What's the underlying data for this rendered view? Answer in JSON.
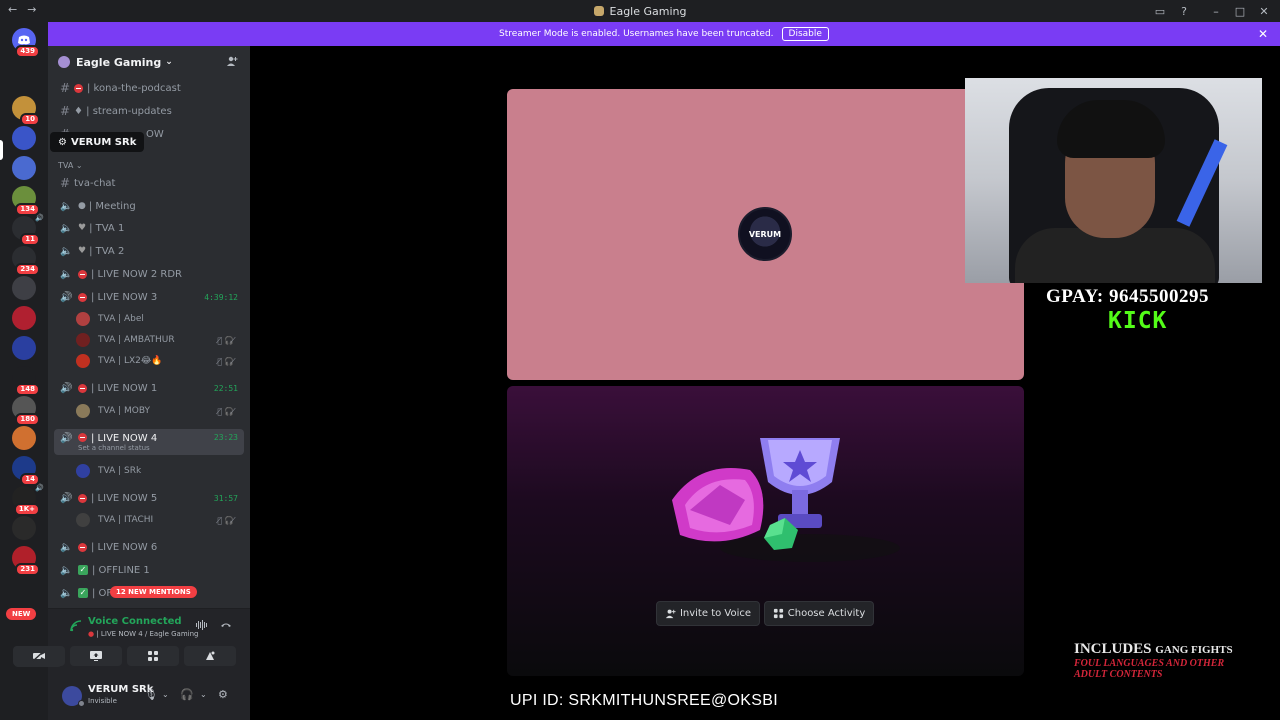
{
  "window": {
    "title": "Eagle Gaming",
    "nav_back": "←",
    "nav_fwd": "→",
    "controls": {
      "inbox": "▭",
      "help": "?",
      "minimize": "–",
      "maximize": "□",
      "close": "✕"
    }
  },
  "banner": {
    "text": "Streamer Mode is enabled. Usernames have been truncated.",
    "disable_label": "Disable",
    "close": "✕",
    "color": "#7a3cf4"
  },
  "guild_rail": {
    "home_badge": "439",
    "items": [
      {
        "badge": "10",
        "color": "#c3913a"
      },
      {
        "badge": "",
        "color": "#3a55c8"
      },
      {
        "badge": "",
        "color": "#4a6ad0"
      },
      {
        "badge": "134",
        "color": "#6b8f3c"
      },
      {
        "badge": "11",
        "color": "#2b2d31",
        "speaker": "🔊"
      },
      {
        "badge": "234",
        "color": "#2b2d31"
      },
      {
        "badge": "",
        "color": "#3e3f45"
      },
      {
        "badge": "",
        "color": "#b02030"
      },
      {
        "badge": "",
        "color": "#2a3fa0"
      },
      {
        "badge": "148",
        "color": "#1e1f22"
      },
      {
        "badge": "180",
        "color": "#555"
      },
      {
        "badge": "",
        "color": "#d07030"
      },
      {
        "badge": "14",
        "color": "#1d3a8a"
      },
      {
        "badge": "1K+",
        "color": "#222",
        "speaker": "🔊"
      },
      {
        "badge": "",
        "color": "#2a2a2a"
      },
      {
        "badge": "231",
        "color": "#b0202a"
      }
    ],
    "new_label": "NEW"
  },
  "server": {
    "name": "Eagle Gaming",
    "chevron": "⌄",
    "add_member_icon": "👤+"
  },
  "tooltip": {
    "text": "VERUM SRk"
  },
  "channels": {
    "top": [
      {
        "label": "| kona-the-podcast"
      },
      {
        "label": "♦ | stream-updates"
      },
      {
        "label": "OW"
      }
    ],
    "category": "TVA",
    "tva_chat": "tva-chat",
    "voice": [
      {
        "label": "| Meeting"
      },
      {
        "label": "| TVA 1"
      },
      {
        "label": "| TVA 2"
      },
      {
        "label": "| LIVE NOW 2 RDR"
      },
      {
        "label": "| LIVE NOW 3",
        "timer": "4:39:12"
      },
      {
        "label": "| LIVE NOW 1",
        "timer": "22:51"
      },
      {
        "label": "| LIVE NOW 4",
        "timer": "23:23",
        "status": "Set a channel status"
      },
      {
        "label": "| LIVE NOW 5",
        "timer": "31:57"
      },
      {
        "label": "| LIVE NOW 6"
      },
      {
        "label": "| OFFLINE 1"
      },
      {
        "label": "| OF"
      }
    ],
    "users": [
      {
        "name": "TVA | Abel",
        "color": "#b04040"
      },
      {
        "name": "TVA | AMBATHUR",
        "color": "#702020"
      },
      {
        "name": "TVA | LX2😂🔥",
        "color": "#c03020"
      },
      {
        "name": "TVA | MOBY",
        "color": "#8a7a5a"
      },
      {
        "name": "TVA | SRk",
        "color": "#3040a0"
      },
      {
        "name": "TVA | ITACHI",
        "color": "#404040"
      }
    ],
    "mute_icons": "🎙̸🎧̸",
    "mentions_label": "12 NEW MENTIONS"
  },
  "voice_panel": {
    "title": "Voice Connected",
    "subtitle": "| LIVE NOW 4 / Eagle Gaming"
  },
  "user": {
    "name": "VERUM SRk",
    "status": "Invisible"
  },
  "stage": {
    "avatar_text": "VERUM",
    "invite_label": "Invite to Voice",
    "activity_label": "Choose Activity"
  },
  "overlay": {
    "gpay": "GPAY: 9645500295",
    "kick": "KICK",
    "upi": "UPI ID: SRKMITHUNSREE@OKSBI",
    "includes_big": "INCLUDES",
    "includes_small": "GANG FIGHTS",
    "warning": "FOUL LANGUAGES AND OTHER ADULT CONTENTS"
  }
}
